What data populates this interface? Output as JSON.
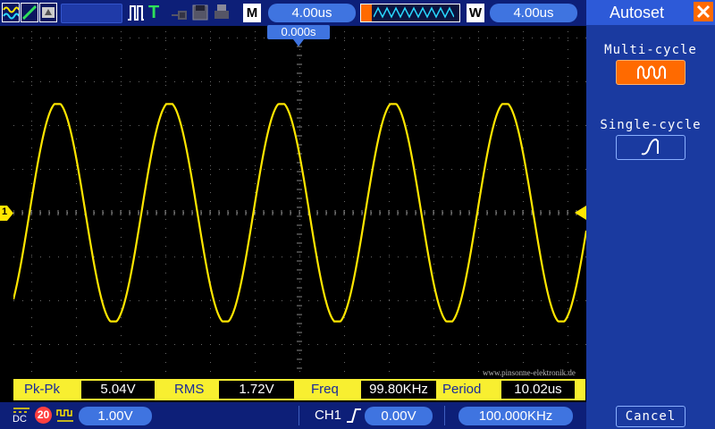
{
  "topbar": {
    "timebase": "4.00us",
    "trigger_mode_letter": "M",
    "window_letter": "W",
    "window_timebase": "4.00us",
    "trigger_letter": "T",
    "trigger_offset": "0.000s"
  },
  "channel_marker": "1",
  "watermark": "www.pinsonne-elektronik.de",
  "measurements": [
    {
      "label": "Pk-Pk",
      "value": "5.04V"
    },
    {
      "label": "RMS",
      "value": "1.72V"
    },
    {
      "label": "Freq",
      "value": "99.80KHz"
    },
    {
      "label": "Period",
      "value": "10.02us"
    }
  ],
  "bottombar": {
    "coupling": "DC",
    "bw_limit": "20",
    "volts_div": "1.00V",
    "trigger_source": "CH1",
    "trigger_level": "0.00V",
    "trigger_freq": "100.000KHz"
  },
  "sidebar": {
    "title": "Autoset",
    "multi_cycle_label": "Multi-cycle",
    "single_cycle_label": "Single-cycle",
    "cancel_label": "Cancel"
  },
  "waveform": {
    "channel": "CH1",
    "frequency_khz": 99.8,
    "peak_to_peak_v": 5.04,
    "volts_per_div": 1.0,
    "time_per_div_us": 4.0
  },
  "colors": {
    "trace": "#ffe600",
    "accent": "#3f74e0",
    "highlight": "#ff6a00",
    "panel": "#0d1f78"
  },
  "icons": [
    "channel-waveform-icon",
    "ramp-icon",
    "display-icon",
    "pulse-icon",
    "trigger-icon",
    "probe-icon",
    "save-icon",
    "print-icon",
    "close-icon",
    "dc-coupling-icon",
    "bandwidth-limit-icon",
    "ac-icon",
    "rising-edge-icon",
    "multi-cycle-icon",
    "single-cycle-icon"
  ]
}
